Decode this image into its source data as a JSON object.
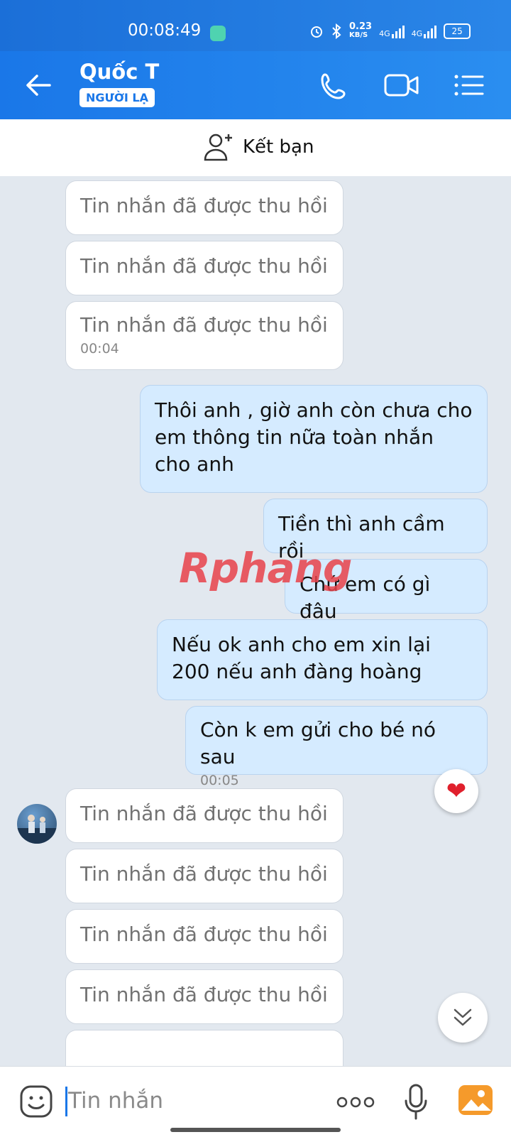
{
  "status_bar": {
    "time": "00:08:49",
    "net_speed": "0.23",
    "net_unit": "KB/S",
    "net1": "4G",
    "net2": "4G",
    "battery": "25"
  },
  "header": {
    "contact_name": "Quốc T",
    "badge": "NGƯỜI LẠ"
  },
  "add_friend": {
    "label": "Kết bạn"
  },
  "messages": [
    {
      "side": "recv",
      "text": "Tin nhắn đã được thu hồi"
    },
    {
      "side": "recv",
      "text": "Tin nhắn đã được thu hồi"
    },
    {
      "side": "recv",
      "text": "Tin nhắn đã được thu hồi",
      "time": "00:04"
    },
    {
      "side": "sent",
      "text": "Thôi anh , giờ anh còn chưa cho em thông tin nữa toàn nhắn cho anh"
    },
    {
      "side": "sent",
      "text": "Tiền thì anh cầm rồi"
    },
    {
      "side": "sent",
      "text": "Chứ em có gì đâu"
    },
    {
      "side": "sent",
      "text": "Nếu ok anh cho em xin lại 200 nếu anh đàng hoàng"
    },
    {
      "side": "sent",
      "text": "Còn k em gửi cho bé nó sau",
      "time": "00:05"
    },
    {
      "side": "recv",
      "text": "Tin nhắn đã được thu hồi"
    },
    {
      "side": "recv",
      "text": "Tin nhắn đã được thu hồi"
    },
    {
      "side": "recv",
      "text": "Tin nhắn đã được thu hồi"
    },
    {
      "side": "recv",
      "text": "Tin nhắn đã được thu hồi"
    }
  ],
  "reaction": "❤",
  "watermark": {
    "part1": "Rphang",
    "part2": ""
  },
  "composer": {
    "placeholder": "Tin nhắn"
  },
  "icons": [
    "back-arrow-icon",
    "phone-icon",
    "video-call-icon",
    "menu-icon",
    "add-friend-icon",
    "heart-icon",
    "chevron-double-down-icon",
    "emoji-icon",
    "more-dots-icon",
    "microphone-icon",
    "gallery-icon"
  ],
  "colors": {
    "header": "#1a77e8",
    "sent_bubble": "#d5ebff",
    "chat_bg": "#e2e8ef"
  }
}
